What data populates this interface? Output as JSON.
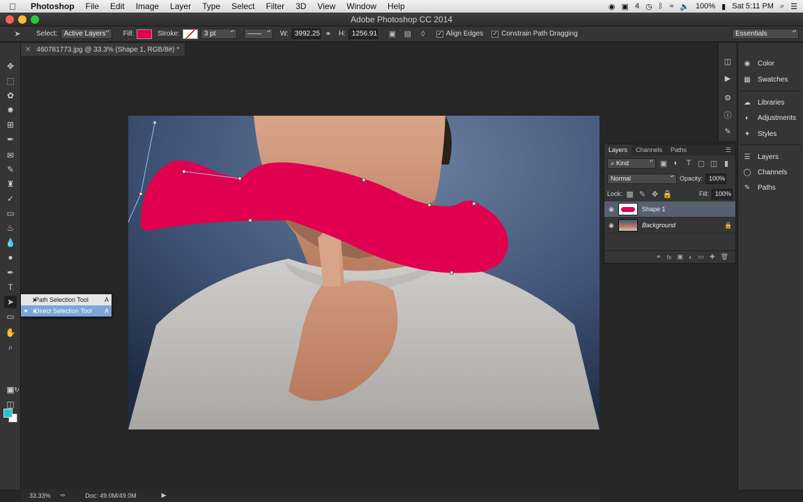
{
  "menubar": {
    "app": "Photoshop",
    "items": [
      "File",
      "Edit",
      "Image",
      "Layer",
      "Type",
      "Select",
      "Filter",
      "3D",
      "View",
      "Window",
      "Help"
    ],
    "status_num": "4",
    "battery": "100%",
    "datetime": "Sat 5:11 PM"
  },
  "window": {
    "title": "Adobe Photoshop CC 2014"
  },
  "options": {
    "select_label": "Select:",
    "select_value": "Active Layers",
    "fill_label": "Fill:",
    "fill_color": "#e0004f",
    "stroke_label": "Stroke:",
    "stroke_width": "3 pt",
    "w_label": "W:",
    "w_value": "3992.25",
    "h_label": "H:",
    "h_value": "1256.91",
    "align_edges": "Align Edges",
    "constrain": "Constrain Path Dragging",
    "workspace": "Essentials"
  },
  "document": {
    "tab_title": "460781773.jpg @ 33.3% (Shape 1, RGB/8#) *"
  },
  "flyout": {
    "items": [
      {
        "label": "Path Selection Tool",
        "key": "A"
      },
      {
        "label": "Direct Selection Tool",
        "key": "A"
      }
    ]
  },
  "status": {
    "zoom": "33.33%",
    "doc": "Doc: 49.0M/49.0M"
  },
  "dock": {
    "group1": [
      "Color",
      "Swatches"
    ],
    "group2": [
      "Libraries",
      "Adjustments",
      "Styles"
    ],
    "group3": [
      "Layers",
      "Channels",
      "Paths"
    ]
  },
  "layers_panel": {
    "tabs": [
      "Layers",
      "Channels",
      "Paths"
    ],
    "filter_kind": "Kind",
    "blend_mode": "Normal",
    "opacity_label": "Opacity:",
    "opacity_value": "100%",
    "lock_label": "Lock:",
    "fill_label": "Fill:",
    "fill_value": "100%",
    "layers": [
      {
        "name": "Shape 1"
      },
      {
        "name": "Background"
      }
    ]
  },
  "colors": {
    "accent_shape": "#e0004f",
    "foreground": "#25c4d3",
    "background": "#ffffff"
  }
}
